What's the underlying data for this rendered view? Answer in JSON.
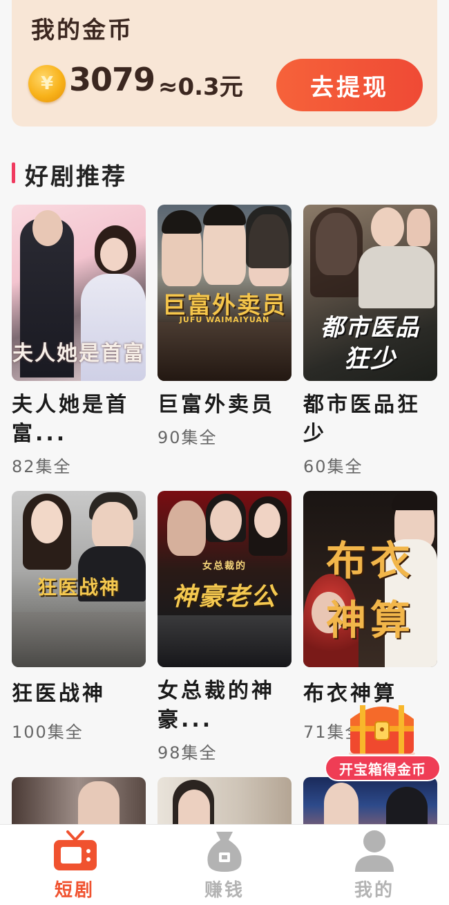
{
  "coins": {
    "title": "我的金币",
    "icon": "yen-coin-icon",
    "icon_glyph": "¥",
    "amount": "3079",
    "approx": "≈0.3元",
    "withdraw_label": "去提现"
  },
  "section": {
    "title": "好剧推荐"
  },
  "dramas": [
    {
      "title": "夫人她是首富...",
      "episodes": "82集全",
      "poster_text": "夫人她是首富",
      "poster_subtext": ""
    },
    {
      "title": "巨富外卖员",
      "episodes": "90集全",
      "poster_text": "巨富外卖员",
      "poster_subtext": "JUFU WAIMAIYUAN"
    },
    {
      "title": "都市医品狂少",
      "episodes": "60集全",
      "poster_text": "都市医品",
      "poster_subtext": "狂少"
    },
    {
      "title": "狂医战神",
      "episodes": "100集全",
      "poster_text": "狂医战神",
      "poster_subtext": ""
    },
    {
      "title": "女总裁的神豪...",
      "episodes": "98集全",
      "poster_text": "神豪老公",
      "poster_subtext": "女总裁的"
    },
    {
      "title": "布衣神算",
      "episodes": "71集全",
      "poster_text": "布衣",
      "poster_subtext": "神算"
    }
  ],
  "treasure": {
    "icon": "treasure-chest-icon",
    "label": "开宝箱得金币"
  },
  "tabs": [
    {
      "label": "短剧",
      "icon": "tv-icon",
      "active": true
    },
    {
      "label": "赚钱",
      "icon": "money-bag-icon",
      "active": false
    },
    {
      "label": "我的",
      "icon": "user-icon",
      "active": false
    }
  ],
  "colors": {
    "accent": "#f0522f",
    "section_bar": "#f03a5f",
    "inactive_tab": "#b3b3b3"
  }
}
